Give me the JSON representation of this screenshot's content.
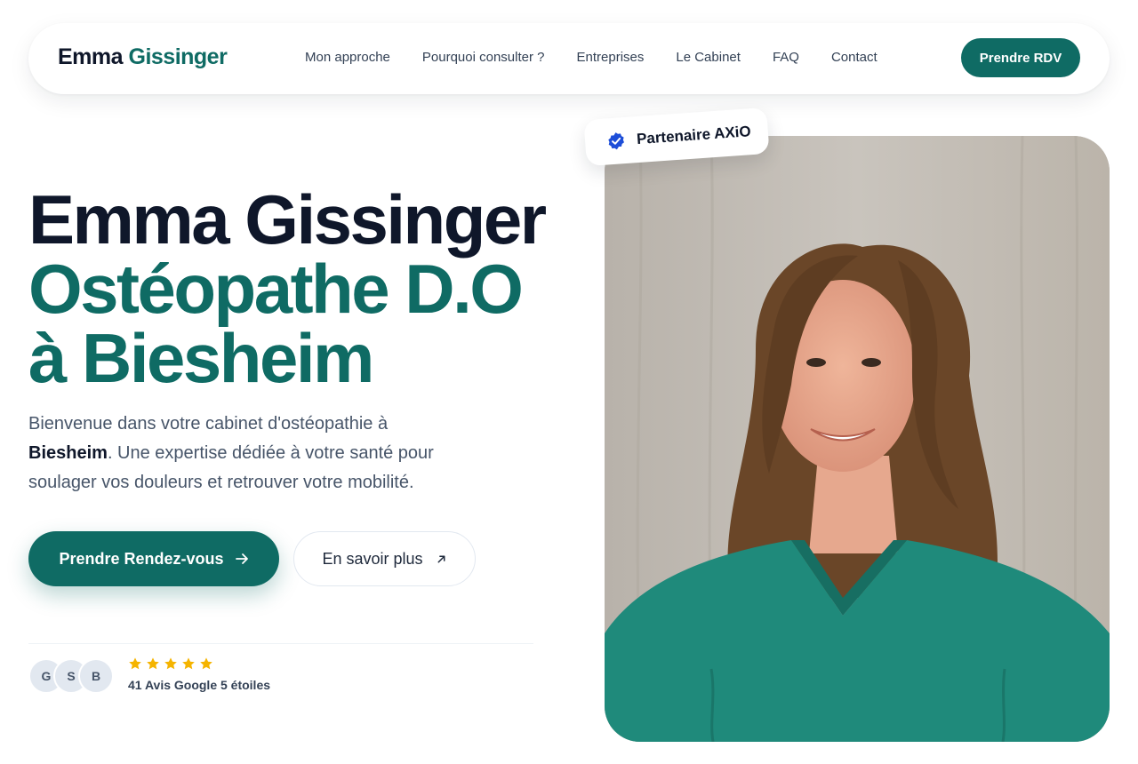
{
  "brand": {
    "first": "Emma",
    "last": "Gissinger"
  },
  "nav": {
    "links": [
      "Mon approche",
      "Pourquoi consulter ?",
      "Entreprises",
      "Le Cabinet",
      "FAQ",
      "Contact"
    ],
    "cta_label": "Prendre RDV"
  },
  "hero": {
    "title_line1": "Emma Gissinger",
    "title_line2": "Ostéopathe D.O",
    "title_line3": "à Biesheim",
    "desc_before": "Bienvenue dans votre cabinet d'ostéopathie à ",
    "desc_strong": "Biesheim",
    "desc_after": ". Une expertise dédiée à votre santé pour soulager vos douleurs et retrouver votre mobilité.",
    "primary_button": "Prendre Rendez-vous",
    "secondary_button": "En savoir plus"
  },
  "reviews": {
    "avatars": [
      "G",
      "S",
      "B"
    ],
    "stars": 5,
    "text": "41 Avis Google 5 étoiles"
  },
  "badge": {
    "text": "Partenaire AXiO"
  },
  "colors": {
    "accent": "#0f6b64",
    "dark": "#0f172a",
    "star": "#f5b400",
    "badge_check": "#1d4ed8"
  }
}
